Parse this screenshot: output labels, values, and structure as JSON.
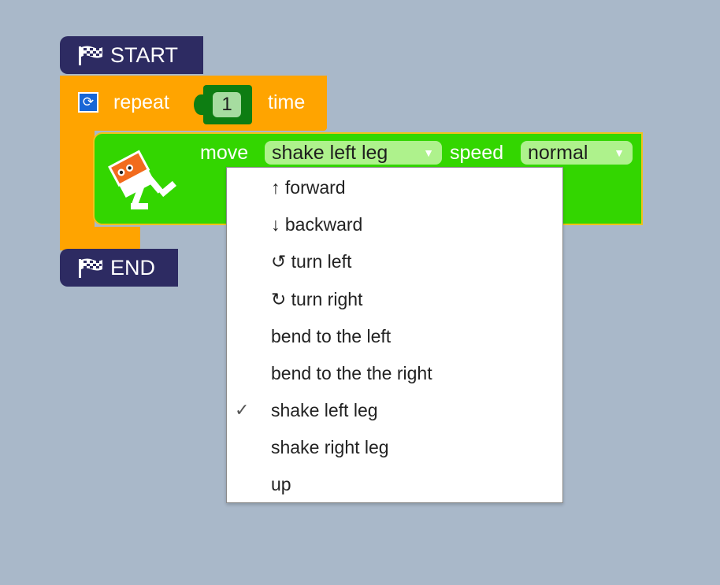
{
  "start_block": {
    "label": "START"
  },
  "end_block": {
    "label": "END"
  },
  "repeat_block": {
    "label": "repeat",
    "count": "1",
    "suffix": "time"
  },
  "move_block": {
    "move_label": "move",
    "leg_selected": "shake left leg",
    "speed_label": "speed",
    "speed_selected": "normal",
    "arrow": "▼"
  },
  "dropdown": {
    "check_mark": "✓",
    "selected_index": 6,
    "items": [
      "↑ forward",
      "↓ backward",
      "↺ turn left",
      "↻ turn right",
      "bend to the left",
      "bend to the the right",
      "shake left leg",
      "shake right leg",
      "up"
    ]
  },
  "colors": {
    "workspace": "#a9b8c9",
    "hat_block": "#2d2b62",
    "repeat_block": "#ffa400",
    "move_block": "#33d600",
    "number_socket": "#0d7d12"
  }
}
